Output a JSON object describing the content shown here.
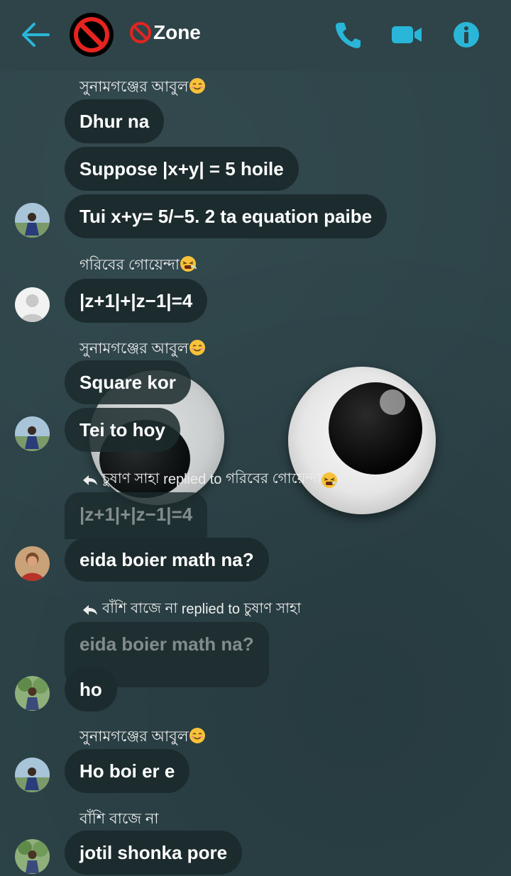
{
  "header": {
    "title": "Zone",
    "title_prefix_icon": "no-entry-icon"
  },
  "messages": [
    {
      "sender": "সুনামগঞ্জের আবুল",
      "lines": [
        "Dhur na",
        "Suppose |x+y| = 5 hoile",
        "Tui x+y= 5/−5. 2 ta equation paibe"
      ]
    },
    {
      "sender": "গরিবের গোয়েন্দা",
      "lines": [
        "|z+1|+|z−1|=4"
      ]
    },
    {
      "sender": "সুনামগঞ্জের আবুল",
      "lines": [
        "Square kor",
        "Tei to hoy"
      ]
    },
    {
      "reply": {
        "who": "চুষাণ সাহা",
        "verb": "replied to",
        "to": "গরিবের গোয়েন্দা",
        "quoted": "|z+1|+|z−1|=4"
      },
      "lines": [
        "eida  boier math na?"
      ]
    },
    {
      "reply": {
        "who": "বাঁশি বাজে না",
        "verb": "replied to",
        "to": "চুষাণ সাহা",
        "quoted": "eida  boier math na?"
      },
      "lines": [
        "ho"
      ]
    },
    {
      "sender": "সুনামগঞ্জের আবুল",
      "lines": [
        "Ho boi er e"
      ]
    },
    {
      "sender": "বাঁশি বাজে না",
      "lines": [
        "jotil shonka pore"
      ]
    }
  ],
  "colors": {
    "accent": "#29b6d8",
    "background": "#2c4348",
    "bubble": "#1c2b2d"
  }
}
